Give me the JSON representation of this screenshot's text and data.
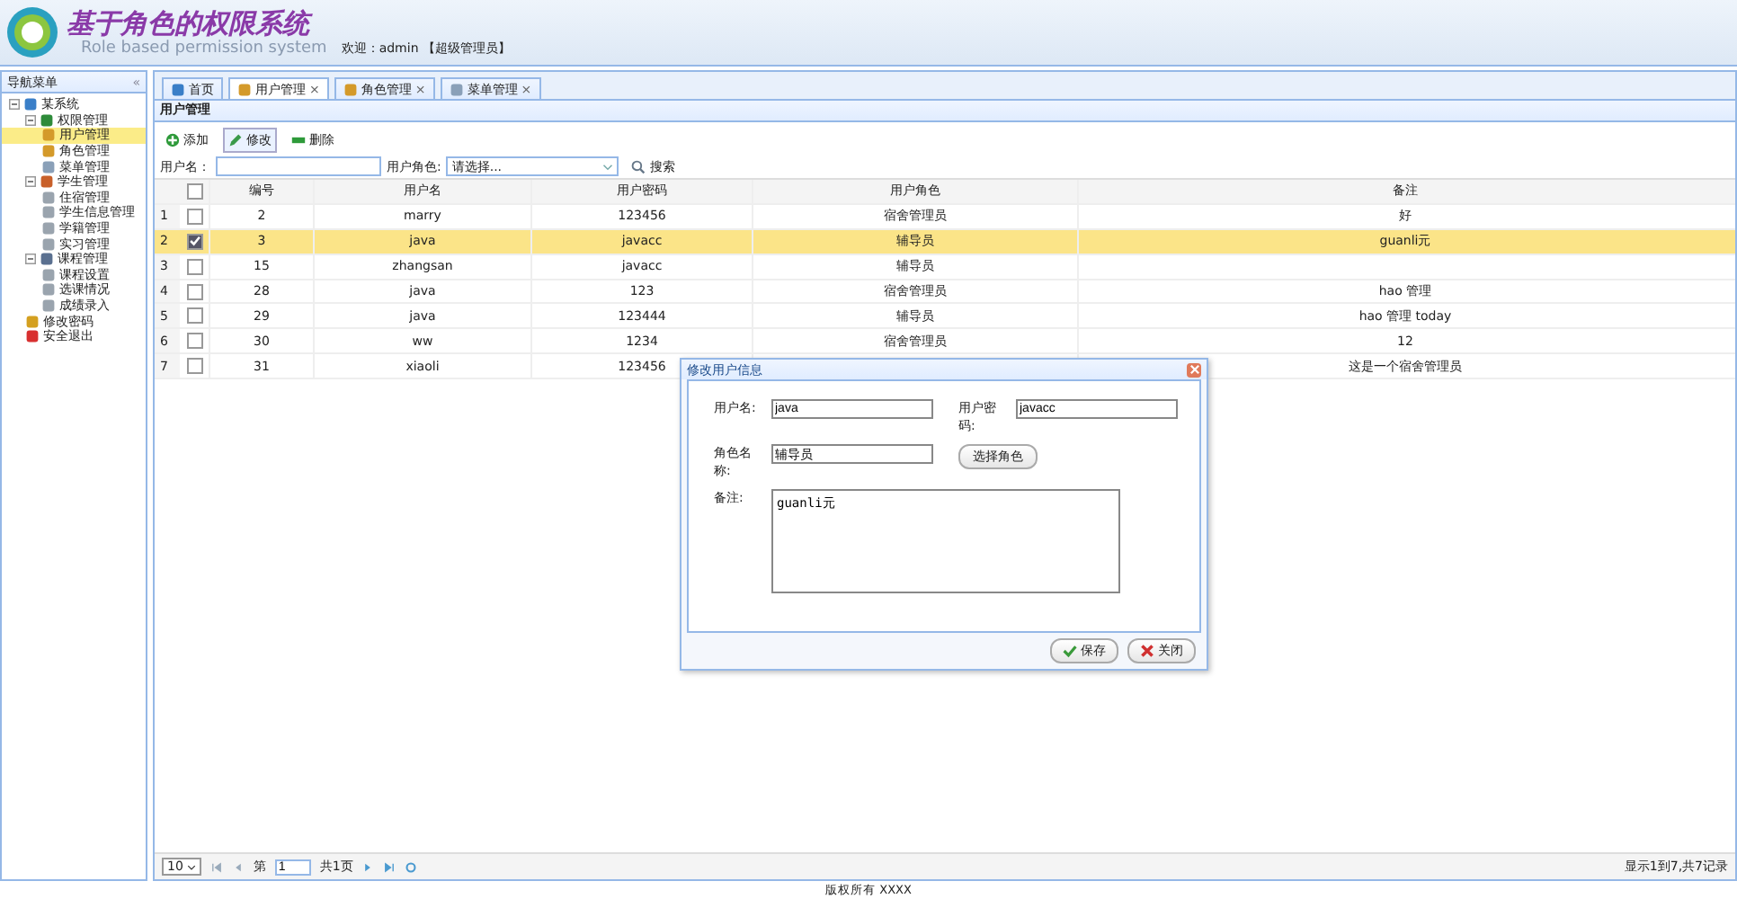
{
  "header": {
    "title": "基于角色的权限系统",
    "subtitle": "Role based permission system",
    "welcome": "欢迎：admin 【超级管理员】"
  },
  "sidebar": {
    "title": "导航菜单",
    "collapse": "«",
    "tree": [
      {
        "label": "某系统",
        "expanded": true,
        "children": [
          {
            "label": "权限管理",
            "expanded": true,
            "children": [
              {
                "label": "用户管理",
                "selected": true
              },
              {
                "label": "角色管理",
                "selected": false
              },
              {
                "label": "菜单管理",
                "selected": false
              }
            ]
          },
          {
            "label": "学生管理",
            "expanded": true,
            "children": [
              {
                "label": "住宿管理",
                "selected": false
              },
              {
                "label": "学生信息管理",
                "selected": false
              },
              {
                "label": "学籍管理",
                "selected": false
              },
              {
                "label": "实习管理",
                "selected": false
              }
            ]
          },
          {
            "label": "课程管理",
            "expanded": true,
            "children": [
              {
                "label": "课程设置",
                "selected": false
              },
              {
                "label": "选课情况",
                "selected": false
              },
              {
                "label": "成绩录入",
                "selected": false
              }
            ]
          },
          {
            "label": "修改密码",
            "selected": false
          },
          {
            "label": "安全退出",
            "selected": false
          }
        ]
      }
    ]
  },
  "tabs": [
    {
      "label": "首页",
      "closable": false,
      "selected": false
    },
    {
      "label": "用户管理",
      "closable": true,
      "selected": true
    },
    {
      "label": "角色管理",
      "closable": true,
      "selected": false
    },
    {
      "label": "菜单管理",
      "closable": true,
      "selected": false
    }
  ],
  "close_glyph": "×",
  "panel": {
    "title": "用户管理",
    "toolbar": [
      {
        "label": "添加",
        "selected": false
      },
      {
        "label": "修改",
        "selected": true
      },
      {
        "label": "删除",
        "selected": false
      }
    ],
    "search": {
      "name_label": "用户名：",
      "role_label": "用户角色:",
      "role_value": "请选择...",
      "button": "搜索"
    },
    "table": {
      "all_checked": false,
      "columns": [
        "编号",
        "用户名",
        "用户密码",
        "用户角色",
        "备注"
      ],
      "rows": [
        {
          "num": "1",
          "checked": false,
          "cells": [
            "2",
            "marry",
            "123456",
            "宿舍管理员",
            "好"
          ]
        },
        {
          "num": "2",
          "checked": true,
          "cells": [
            "3",
            "java",
            "javacc",
            "辅导员",
            "guanli元"
          ]
        },
        {
          "num": "3",
          "checked": false,
          "cells": [
            "15",
            "zhangsan",
            "javacc",
            "辅导员",
            null
          ]
        },
        {
          "num": "4",
          "checked": false,
          "cells": [
            "28",
            "java",
            "123",
            "宿舍管理员",
            "hao 管理"
          ]
        },
        {
          "num": "5",
          "checked": false,
          "cells": [
            "29",
            "java",
            "123444",
            "辅导员",
            "hao 管理 today"
          ]
        },
        {
          "num": "6",
          "checked": false,
          "cells": [
            "30",
            "ww",
            "1234",
            "宿舍管理员",
            "12"
          ]
        },
        {
          "num": "7",
          "checked": false,
          "cells": [
            "31",
            "xiaoli",
            "123456",
            null,
            "这是一个宿舍管理员"
          ]
        }
      ]
    },
    "pager": {
      "page_size": "10",
      "page_label": "第",
      "page": "1",
      "total_pages": "共1页",
      "summary": "显示1到7,共7记录"
    }
  },
  "dialog": {
    "title": "修改用户信息",
    "fields": [
      {
        "label": "用户名:",
        "value": "java"
      },
      {
        "label": "用户密码:",
        "value": "javacc"
      },
      {
        "label": "角色名称:",
        "value": "辅导员"
      }
    ],
    "choose_role": "选择角色",
    "remark_label": "备注:",
    "remark": "guanli元",
    "buttons": [
      {
        "label": "保存",
        "kind": "save"
      },
      {
        "label": "关闭",
        "kind": "close"
      }
    ]
  },
  "footer": "版权所有 XXXX"
}
